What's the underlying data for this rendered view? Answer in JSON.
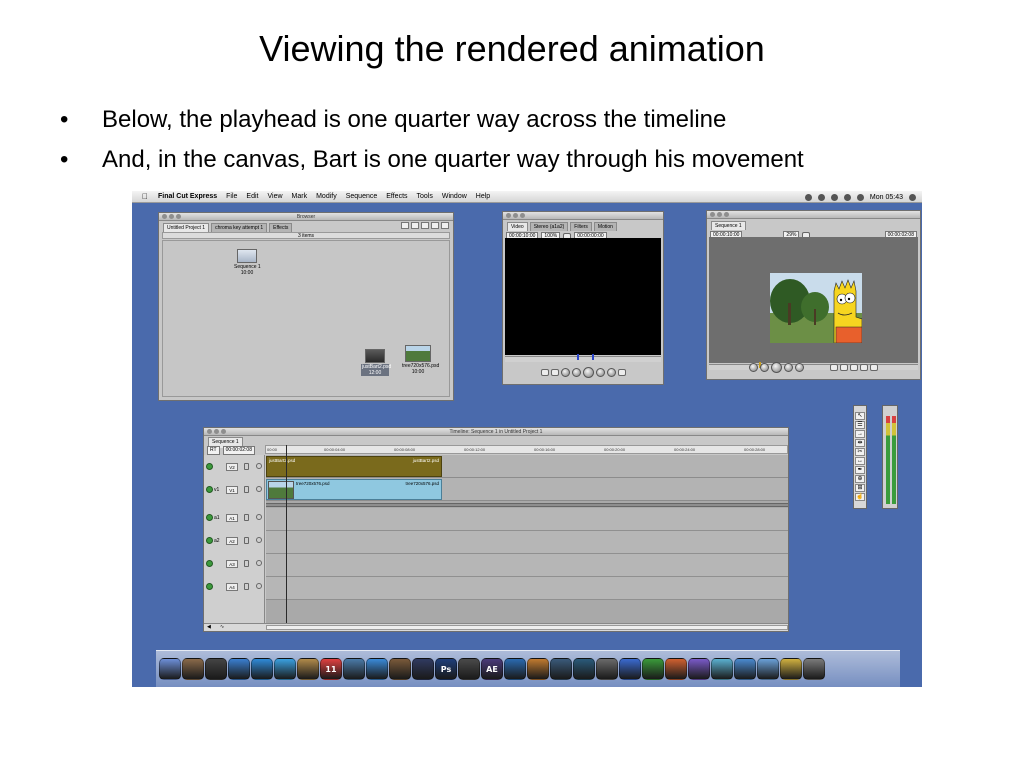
{
  "slide": {
    "title": "Viewing  the rendered animation",
    "bullets": [
      "Below, the playhead is one quarter way across the timeline",
      "And, in the canvas, Bart is one quarter way through his movement"
    ],
    "bullet_char": "•"
  },
  "menubar": {
    "app": "Final Cut Express",
    "items": [
      "File",
      "Edit",
      "View",
      "Mark",
      "Modify",
      "Sequence",
      "Effects",
      "Tools",
      "Window",
      "Help"
    ],
    "clock": "Mon 05:43"
  },
  "browser": {
    "title": "Browser",
    "tabs": [
      "Untitled Project 1",
      "chroma key attempt 1",
      "Effects"
    ],
    "column_header": "3 items",
    "clips": [
      {
        "name": "Sequence 1",
        "duration": "10:00"
      },
      {
        "name": "justBart2.psd",
        "duration": "12:00"
      },
      {
        "name": "tree720x576.psd",
        "duration": "10:00"
      }
    ]
  },
  "viewer": {
    "tabs": [
      "Video",
      "Stereo (a1a2)",
      "Filters",
      "Motion"
    ],
    "timecode_left": "00:00:10:00",
    "zoom": "100%",
    "timecode_right": "00:00:00:00"
  },
  "canvas": {
    "tab": "Sequence 1",
    "timecode_left": "00:00:10:00",
    "zoom": "29%",
    "timecode_right": "00:00:02:08"
  },
  "timeline": {
    "title": "Timeline: Sequence 1 in Untitled Project 1",
    "tab": "Sequence 1",
    "rt": "RT",
    "current_tc": "00:00:02:08",
    "ruler": [
      "00:00",
      "00:00:04:00",
      "00:00:08:00",
      "00:00:12:00",
      "00:00:16:00",
      "00:00:20:00",
      "00:00:24:00",
      "00:00:28:00"
    ],
    "video_tracks": [
      {
        "src": "",
        "name": "V2",
        "clip_start_label": "justBart2.psd",
        "clip_end_label": "justBart2.psd"
      },
      {
        "src": "v1",
        "name": "V1",
        "clip_start_label": "tree720x576.psd",
        "clip_end_label": "tree720x576.psd"
      }
    ],
    "audio_tracks": [
      {
        "src": "a1",
        "name": "A1"
      },
      {
        "src": "a2",
        "name": "A2"
      },
      {
        "src": "",
        "name": "A3"
      },
      {
        "src": "",
        "name": "A4"
      }
    ],
    "playhead_fraction": 0.25
  },
  "colors": {
    "desktop": "#4a6aac",
    "bart_clip": "#7a6a1c",
    "tree_clip": "#8fc8e0"
  },
  "dock": {
    "icons": [
      "finder-icon",
      "preview-icon",
      "dashboard-icon",
      "mail-icon",
      "safari-icon",
      "ichat-icon",
      "address-book-icon",
      "ical-icon",
      "iphoto-icon",
      "itunes-icon",
      "imovie-icon",
      "final-cut-icon",
      "photoshop-icon",
      "clapper-icon",
      "after-effects-icon",
      "quicktime-icon",
      "garageband-icon",
      "layout-icon",
      "time-machine-icon",
      "system-prefs-icon",
      "word-icon",
      "excel-icon",
      "powerpoint-icon",
      "entourage-icon",
      "messenger-icon",
      "ical-alt-icon",
      "folder-icon",
      "documents-icon",
      "trash-icon"
    ],
    "labels": {
      "photoshop-icon": "Ps",
      "after-effects-icon": "AE",
      "ical-icon": "11"
    }
  }
}
